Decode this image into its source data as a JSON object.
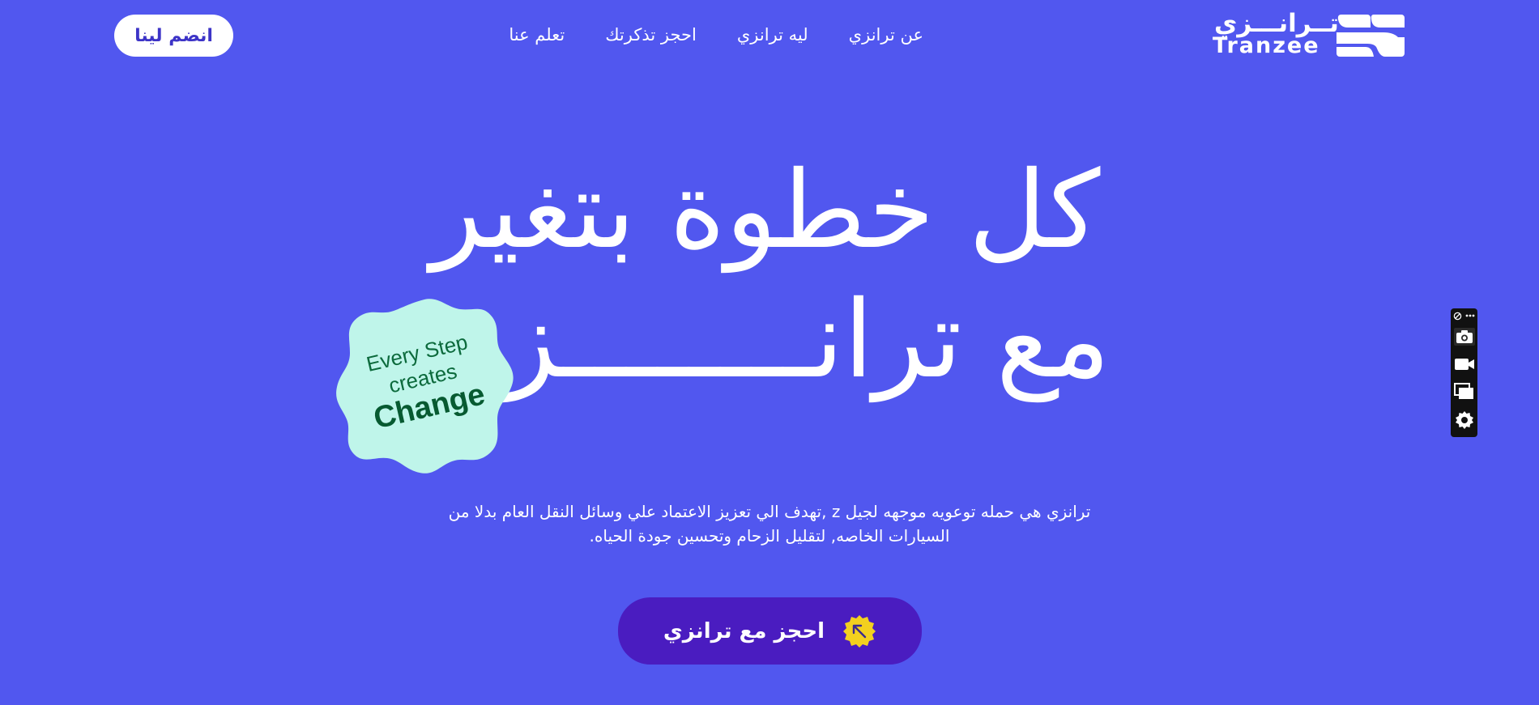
{
  "colors": {
    "background": "#5157ef",
    "cta_background": "#4a1cc0",
    "badge_background": "#bff5ea",
    "badge_text": "#0c6a3c",
    "cta_icon": "#f3d01f",
    "join_text": "#3d34c7"
  },
  "header": {
    "join_button": "انضم لينا",
    "nav": [
      {
        "label": "عن ترانزي"
      },
      {
        "label": "ليه ترانزي"
      },
      {
        "label": "احجز تذكرتك"
      },
      {
        "label": "تعلم عنا"
      }
    ],
    "brand": {
      "arabic": "تــرانـــزي",
      "latin": "Tranzee"
    }
  },
  "hero": {
    "title_line1": "كل خطوة بتغير",
    "title_line2": "مع ترانــــــــزي",
    "badge": {
      "line1": "Every Step",
      "line2": "creates",
      "line3": "Change"
    },
    "description": "ترانزي هي حمله توعويه موجهه لجيل z ,تهدف الي تعزيز الاعتماد علي وسائل النقل العام بدلا من السيارات الخاصه, لتقليل الزحام وتحسين جودة الحياه.",
    "cta_label": "احجز مع ترانزي"
  },
  "toolbar": {
    "icons": [
      "extension-icon",
      "more-icon",
      "camera-icon",
      "video-icon",
      "layers-icon",
      "settings-icon"
    ]
  }
}
